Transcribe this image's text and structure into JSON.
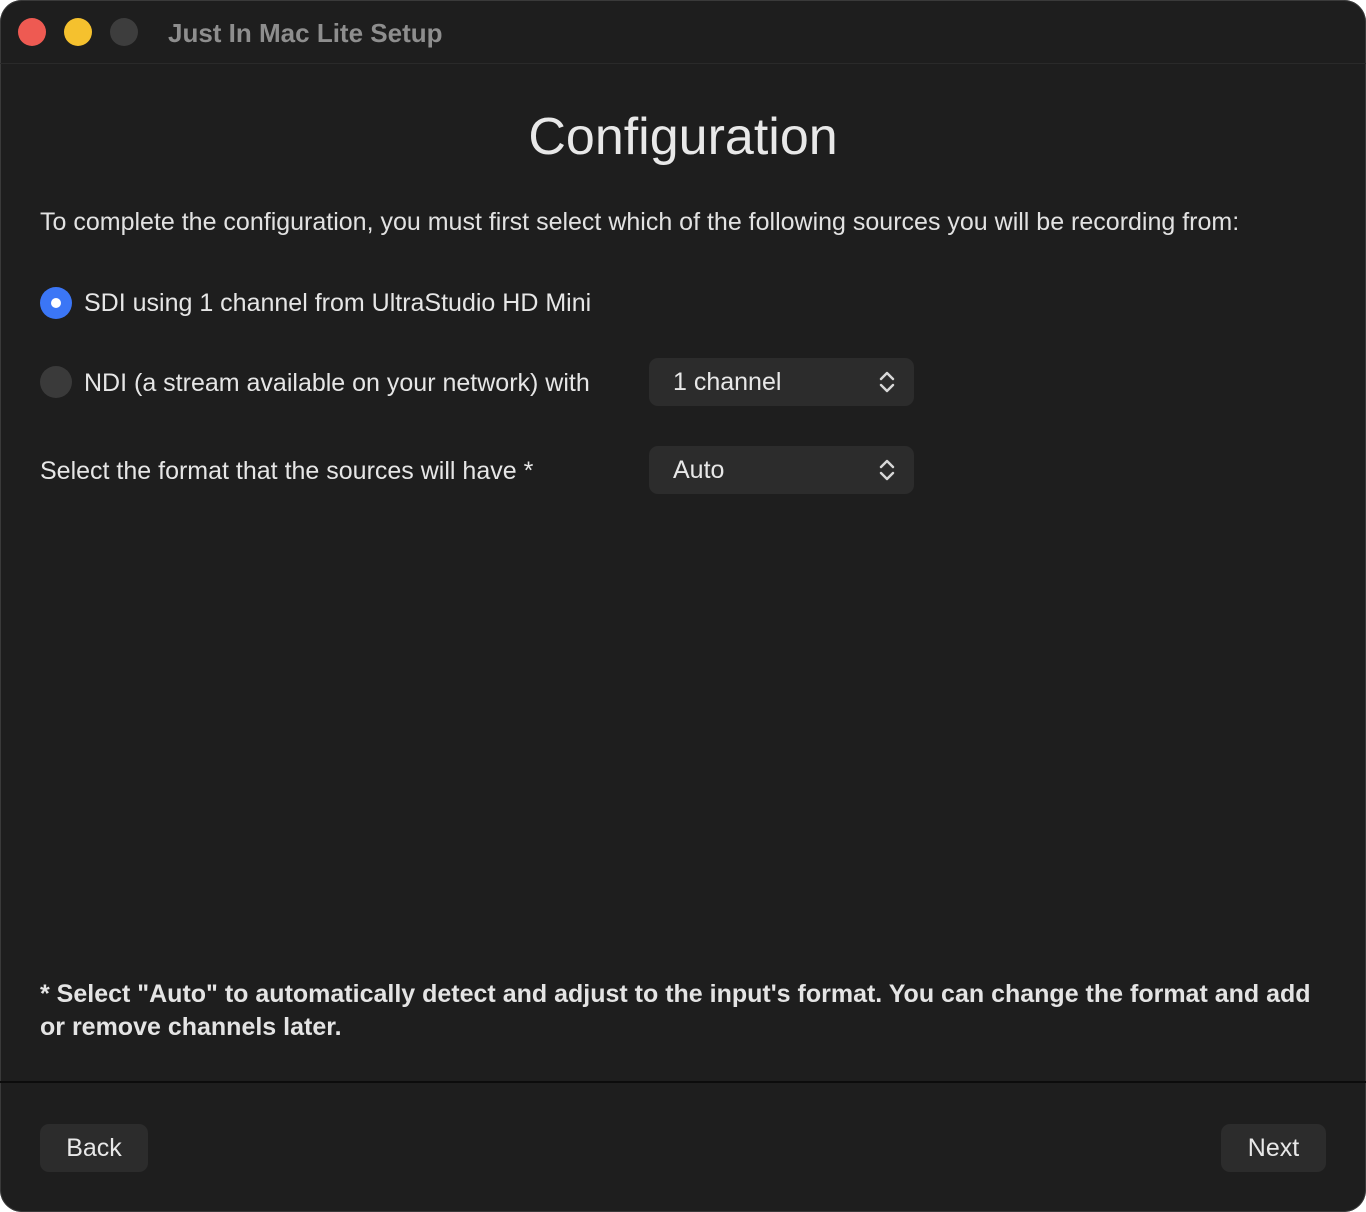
{
  "window": {
    "title": "Just In Mac Lite Setup"
  },
  "page": {
    "title": "Configuration",
    "intro": "To complete the configuration, you must first select which of the following sources you will be recording from:"
  },
  "sources": {
    "sdi": {
      "label": "SDI using 1 channel from UltraStudio HD Mini",
      "selected": true
    },
    "ndi": {
      "label": "NDI (a stream available on your network) with",
      "selected": false,
      "channels_value": "1 channel"
    }
  },
  "format": {
    "label": "Select the format that the sources will have *",
    "value": "Auto"
  },
  "footnote": "* Select \"Auto\" to automatically detect and adjust to the input's format. You can change the format and add or remove channels later.",
  "buttons": {
    "back": "Back",
    "next": "Next"
  },
  "colors": {
    "accent": "#3b76f6",
    "close": "#ee5a52",
    "minimize": "#f5c12e",
    "zoom_inactive": "#3d3d3d",
    "background": "#1e1e1e"
  },
  "icons": {
    "popup_indicator": "chevron-up-down-icon"
  }
}
